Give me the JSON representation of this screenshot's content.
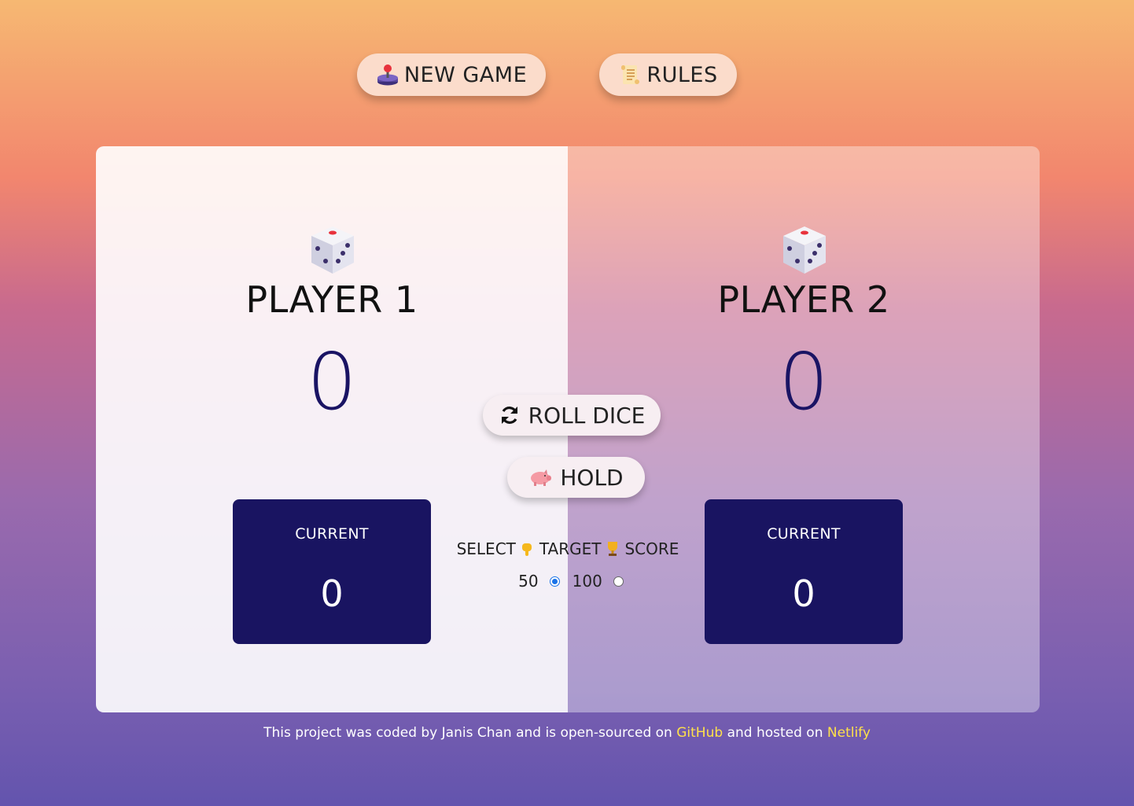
{
  "toolbar": {
    "new_game_label": "NEW GAME",
    "new_game_icon": "joystick-icon",
    "rules_label": "RULES",
    "rules_icon": "scroll-icon"
  },
  "players": [
    {
      "name": "PLAYER 1",
      "score": "0",
      "current_label": "CURRENT",
      "current_score": "0",
      "active": true
    },
    {
      "name": "PLAYER 2",
      "score": "0",
      "current_label": "CURRENT",
      "current_score": "0",
      "active": false
    }
  ],
  "actions": {
    "roll_label": "ROLL DICE",
    "roll_icon": "refresh-icon",
    "hold_label": "HOLD",
    "hold_icon": "pig-icon"
  },
  "target": {
    "select_word": "SELECT",
    "target_word": "TARGET",
    "score_word": "SCORE",
    "options": [
      {
        "label": "50",
        "checked": true
      },
      {
        "label": "100",
        "checked": false
      }
    ]
  },
  "footer": {
    "text1": "This project was coded by Janis Chan and is open-sourced on",
    "link1": "GitHub",
    "text2": "and hosted on",
    "link2": "Netlify"
  },
  "colors": {
    "current_box": "#191461",
    "score": "#1a1464",
    "link": "#ffe14a",
    "button_bg": "#fbdccb"
  }
}
